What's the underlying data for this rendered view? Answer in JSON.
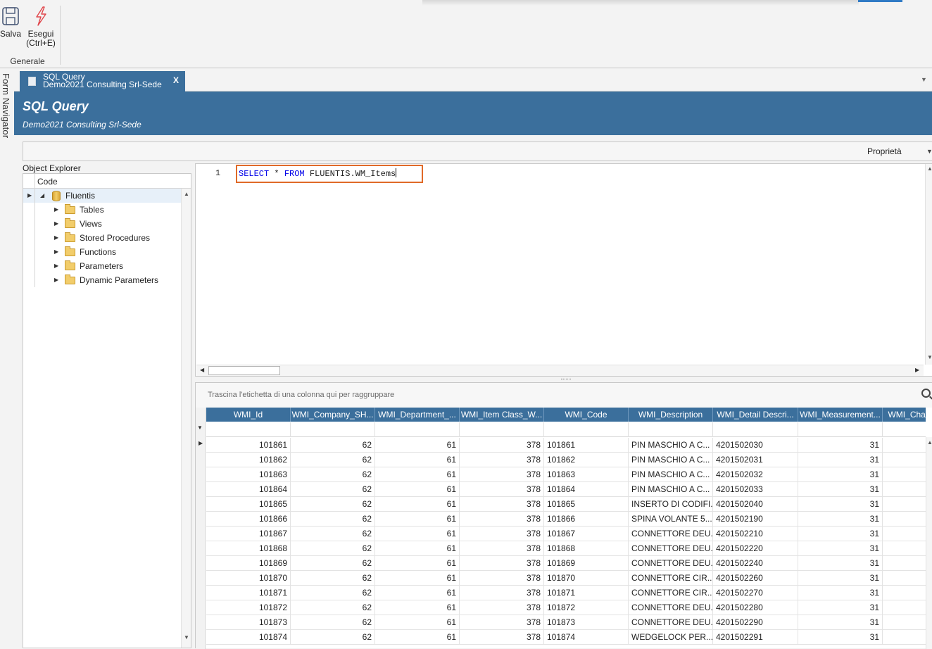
{
  "ribbon": {
    "save_label": "Salva",
    "execute_label_line1": "Esegui",
    "execute_label_line2": "(Ctrl+E)",
    "group_label": "Generale"
  },
  "navigator": {
    "label": "Form Navigator"
  },
  "tab": {
    "title": "SQL Query",
    "subtitle": "Demo2021 Consulting Srl-Sede",
    "close": "X"
  },
  "banner": {
    "title": "SQL Query",
    "subtitle": "Demo2021 Consulting Srl-Sede"
  },
  "properties": {
    "label": "Proprietà"
  },
  "object_explorer": {
    "title": "Object Explorer",
    "column": "Code",
    "root": "Fluentis",
    "children": [
      "Tables",
      "Views",
      "Stored Procedures",
      "Functions",
      "Parameters",
      "Dynamic Parameters"
    ]
  },
  "editor": {
    "line_number": "1",
    "kw_select": "SELECT",
    "star": " * ",
    "kw_from": "FROM",
    "table": " FLUENTIS.WM_Items"
  },
  "grid": {
    "group_hint": "Trascina l'etichetta di una colonna qui per raggruppare",
    "columns": [
      "WMI_Id",
      "WMI_Company_SH...",
      "WMI_Department_...",
      "WMI_Item Class_W...",
      "WMI_Code",
      "WMI_Description",
      "WMI_Detail Descri...",
      "WMI_Measurement...",
      "WMI_Chara"
    ],
    "rows": [
      [
        "101861",
        "62",
        "61",
        "378",
        "101861",
        "PIN MASCHIO A C...",
        "4201502030",
        "31"
      ],
      [
        "101862",
        "62",
        "61",
        "378",
        "101862",
        "PIN MASCHIO A C...",
        "4201502031",
        "31"
      ],
      [
        "101863",
        "62",
        "61",
        "378",
        "101863",
        "PIN MASCHIO A C...",
        "4201502032",
        "31"
      ],
      [
        "101864",
        "62",
        "61",
        "378",
        "101864",
        "PIN MASCHIO A C...",
        "4201502033",
        "31"
      ],
      [
        "101865",
        "62",
        "61",
        "378",
        "101865",
        "INSERTO DI CODIFI...",
        "4201502040",
        "31"
      ],
      [
        "101866",
        "62",
        "61",
        "378",
        "101866",
        "SPINA VOLANTE 5...",
        "4201502190",
        "31"
      ],
      [
        "101867",
        "62",
        "61",
        "378",
        "101867",
        "CONNETTORE DEU...",
        "4201502210",
        "31"
      ],
      [
        "101868",
        "62",
        "61",
        "378",
        "101868",
        "CONNETTORE DEU...",
        "4201502220",
        "31"
      ],
      [
        "101869",
        "62",
        "61",
        "378",
        "101869",
        "CONNETTORE DEU...",
        "4201502240",
        "31"
      ],
      [
        "101870",
        "62",
        "61",
        "378",
        "101870",
        "CONNETTORE CIR...",
        "4201502260",
        "31"
      ],
      [
        "101871",
        "62",
        "61",
        "378",
        "101871",
        "CONNETTORE CIR...",
        "4201502270",
        "31"
      ],
      [
        "101872",
        "62",
        "61",
        "378",
        "101872",
        "CONNETTORE DEU...",
        "4201502280",
        "31"
      ],
      [
        "101873",
        "62",
        "61",
        "378",
        "101873",
        "CONNETTORE DEU...",
        "4201502290",
        "31"
      ],
      [
        "101874",
        "62",
        "61",
        "378",
        "101874",
        "WEDGELOCK PER...",
        "4201502291",
        "31"
      ]
    ]
  }
}
